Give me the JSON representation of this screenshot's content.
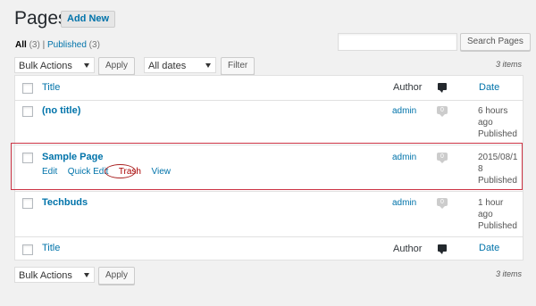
{
  "header": {
    "title": "Pages",
    "add_new_label": "Add New"
  },
  "views": {
    "all_label": "All",
    "all_count": "(3)",
    "separator": "|",
    "published_label": "Published",
    "published_count": "(3)"
  },
  "search": {
    "value": "",
    "button_label": "Search Pages"
  },
  "top_nav": {
    "bulk_actions": "Bulk Actions",
    "apply_label": "Apply",
    "dates_filter": "All dates",
    "filter_label": "Filter",
    "items_count": "3 items"
  },
  "table": {
    "columns": {
      "title": "Title",
      "author": "Author",
      "date": "Date"
    },
    "rows": [
      {
        "title": "(no title)",
        "author": "admin",
        "comments": "0",
        "date_line1": "6 hours",
        "date_line2": "ago",
        "status": "Published"
      },
      {
        "title": "Sample Page",
        "author": "admin",
        "comments": "0",
        "date_line1": "2015/08/1",
        "date_line2": "8",
        "status": "Published",
        "actions": {
          "edit": "Edit",
          "quick_edit": "Quick Edit",
          "trash": "Trash",
          "view": "View"
        }
      },
      {
        "title": "Techbuds",
        "author": "admin",
        "comments": "0",
        "date_line1": "1 hour",
        "date_line2": "ago",
        "status": "Published"
      }
    ]
  },
  "bottom_nav": {
    "bulk_actions": "Bulk Actions",
    "apply_label": "Apply",
    "items_count": "3 items"
  },
  "colors": {
    "link": "#0073aa",
    "highlight_box": "#cc3344"
  }
}
